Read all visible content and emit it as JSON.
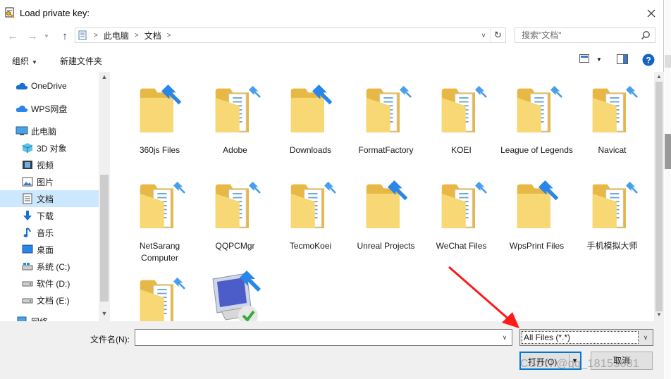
{
  "window": {
    "title": "Load private key:",
    "close_icon": "close-icon"
  },
  "nav": {
    "path": [
      "此电脑",
      "文档"
    ],
    "search_placeholder": "搜索\"文档\""
  },
  "toolbar": {
    "organize_label": "组织",
    "new_folder_label": "新建文件夹"
  },
  "sidebar": {
    "items": [
      {
        "label": "OneDrive",
        "icon": "cloud-icon"
      },
      {
        "label": "WPS网盘",
        "icon": "wps-cloud-icon"
      },
      {
        "label": "此电脑",
        "icon": "computer-icon"
      },
      {
        "label": "3D 对象",
        "icon": "cube-icon"
      },
      {
        "label": "视频",
        "icon": "video-icon"
      },
      {
        "label": "图片",
        "icon": "picture-icon"
      },
      {
        "label": "文档",
        "icon": "document-icon"
      },
      {
        "label": "下载",
        "icon": "download-icon"
      },
      {
        "label": "音乐",
        "icon": "music-icon"
      },
      {
        "label": "桌面",
        "icon": "desktop-icon"
      },
      {
        "label": "系统 (C:)",
        "icon": "system-drive-icon"
      },
      {
        "label": "软件 (D:)",
        "icon": "drive-icon"
      },
      {
        "label": "文档 (E:)",
        "icon": "drive-icon"
      },
      {
        "label": "网络",
        "icon": "network-icon"
      }
    ],
    "selected": "文档"
  },
  "files": {
    "items": [
      {
        "name": "360js Files",
        "icon": "folder-shortcut-icon"
      },
      {
        "name": "Adobe",
        "icon": "folder-icon"
      },
      {
        "name": "Downloads",
        "icon": "folder-shortcut-icon"
      },
      {
        "name": "FormatFactory",
        "icon": "folder-icon"
      },
      {
        "name": "KOEI",
        "icon": "folder-icon"
      },
      {
        "name": "League of Legends",
        "icon": "folder-icon"
      },
      {
        "name": "Navicat",
        "icon": "folder-icon"
      },
      {
        "name": "NetSarang Computer",
        "icon": "folder-icon"
      },
      {
        "name": "QQPCMgr",
        "icon": "folder-icon"
      },
      {
        "name": "TecmoKoei",
        "icon": "folder-icon"
      },
      {
        "name": "Unreal Projects",
        "icon": "folder-shortcut-icon"
      },
      {
        "name": "WeChat Files",
        "icon": "folder-icon"
      },
      {
        "name": "WpsPrint Files",
        "icon": "folder-shortcut-icon"
      },
      {
        "name": "手机模拟大师",
        "icon": "folder-icon"
      },
      {
        "name": "",
        "icon": "folder-icon"
      },
      {
        "name": "",
        "icon": "network-computer-icon"
      }
    ]
  },
  "footer": {
    "filename_label": "文件名(N):",
    "filename_value": "",
    "filter_value": "All Files (*.*)",
    "open_label": "打开(O)",
    "cancel_label": "取消"
  },
  "watermark": "CSDN @qq_18153681",
  "colors": {
    "folder": "#f8d775",
    "folder_dark": "#e8b846",
    "selection": "#cce8ff",
    "accent": "#0078d7",
    "annotation_arrow": "#ff1a1a"
  }
}
